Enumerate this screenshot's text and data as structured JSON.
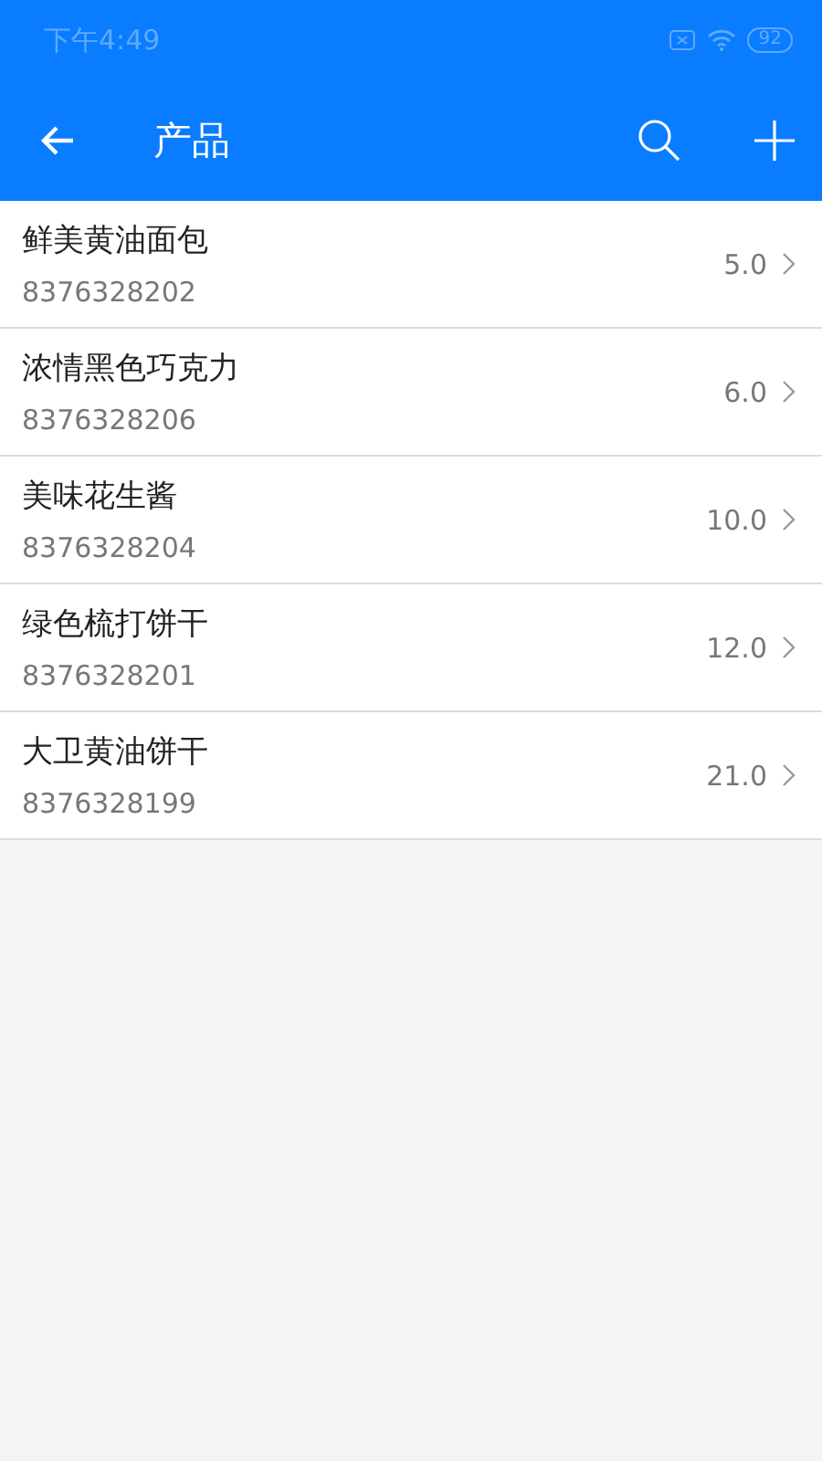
{
  "status_bar": {
    "time": "下午4:49",
    "battery": "92"
  },
  "app_bar": {
    "title": "产品"
  },
  "products": [
    {
      "name": "鲜美黄油面包",
      "code": "8376328202",
      "price": "5.0"
    },
    {
      "name": "浓情黑色巧克力",
      "code": "8376328206",
      "price": "6.0"
    },
    {
      "name": "美味花生酱",
      "code": "8376328204",
      "price": "10.0"
    },
    {
      "name": "绿色梳打饼干",
      "code": "8376328201",
      "price": "12.0"
    },
    {
      "name": "大卫黄油饼干",
      "code": "8376328199",
      "price": "21.0"
    }
  ]
}
